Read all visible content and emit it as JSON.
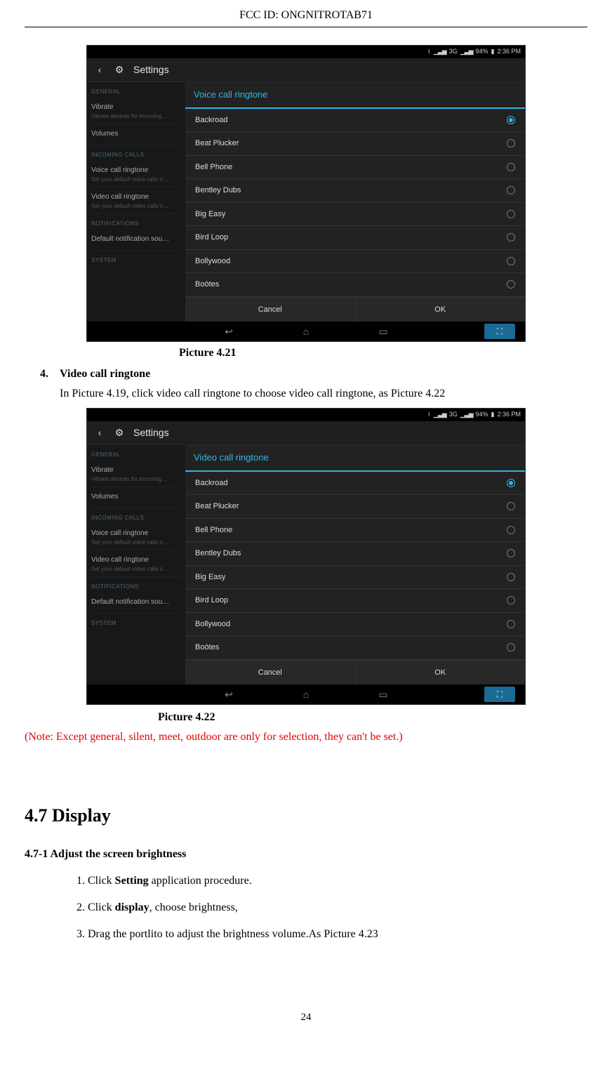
{
  "header": {
    "fcc": "FCC ID: ONGNITROTAB71"
  },
  "statusbar": {
    "time": "2:36 PM",
    "battery": "94%",
    "net": "3G"
  },
  "actionbar": {
    "title": "Settings"
  },
  "left": {
    "sec_general": "GENERAL",
    "vibrate": "Vibrate",
    "vibrate_sub": "Vibrate devices for incoming…",
    "volumes": "Volumes",
    "sec_incoming": "INCOMING CALLS",
    "voice": "Voice call ringtone",
    "voice_sub": "Set your default voice calls ri…",
    "video": "Video call ringtone",
    "video_sub": "Set your default video calls ri…",
    "sec_notif": "NOTIFICATIONS",
    "default_notif": "Default notification sou…",
    "sec_system": "SYSTEM"
  },
  "dialog1": {
    "title": "Voice call ringtone",
    "items": [
      "Backroad",
      "Beat Plucker",
      "Bell Phone",
      "Bentley Dubs",
      "Big Easy",
      "Bird Loop",
      "Bollywood",
      "Boötes"
    ],
    "selected_index": 0,
    "cancel": "Cancel",
    "ok": "OK"
  },
  "dialog2": {
    "title": "Video call ringtone",
    "items": [
      "Backroad",
      "Beat Plucker",
      "Bell Phone",
      "Bentley Dubs",
      "Big Easy",
      "Bird Loop",
      "Bollywood",
      "Boötes"
    ],
    "selected_index": 0,
    "cancel": "Cancel",
    "ok": "OK"
  },
  "captions": {
    "pic421": "Picture 4.21",
    "pic422": "Picture 4.22"
  },
  "text": {
    "item4_num": "4.",
    "item4_title": "Video call ringtone",
    "item4_body": "In Picture 4.19, click video call ringtone to choose video call ringtone, as Picture 4.22",
    "red_note": "(Note: Except general, silent, meet, outdoor are only for selection, they can't be set.)",
    "sec47": "4.7 Display",
    "sec47_1": "4.7-1 Adjust the screen brightness",
    "steps": [
      {
        "pre": "Click ",
        "bold": "Setting",
        "post": " application procedure."
      },
      {
        "pre": "Click ",
        "bold": "display",
        "post": ", choose brightness,"
      },
      {
        "pre": "",
        "bold": "",
        "post": "Drag the portlito to adjust the brightness volume.As Picture 4.23"
      }
    ]
  },
  "page_number": "24"
}
